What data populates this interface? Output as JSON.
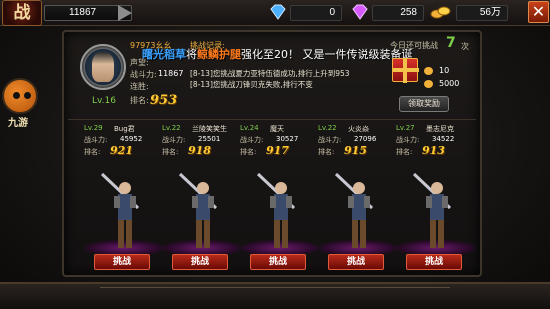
{
  "topbar": {
    "battle_icon_label": "战",
    "power_value": "11867",
    "diamond_blue": "0",
    "diamond_pink": "258",
    "gold": "56万",
    "close_label": "✕"
  },
  "sidebar": {
    "helper_label": "九游"
  },
  "player": {
    "name": "97973幺幺",
    "level": "Lv.16",
    "prestige_label": "声望:",
    "power_label": "战斗力:",
    "power_value": "11867",
    "streak_label": "连胜:",
    "rank_label": "排名:",
    "rank_value": "953"
  },
  "log": {
    "title": "挑战记录:",
    "marquee_name": "曙光稻草",
    "marquee_connector": "将",
    "marquee_item": "鲸鳞护腿",
    "marquee_tail": "强化至20！ 又是一件传说级装备诞",
    "lines": [
      "[8-13]您挑战夏力亚特伍德成功,排行上升到953",
      "[8-13]您挑战刀锋贝克失败,排行不变"
    ]
  },
  "today": {
    "label": "今日还可挑战",
    "count": "7",
    "unit": "次",
    "reward_a": "10",
    "reward_b": "5000",
    "claim_label": "领取奖励"
  },
  "opponents": [
    {
      "level": "Lv.29",
      "name": "Bug君",
      "power_label": "战斗力:",
      "power": "45952",
      "rank_label": "排名:",
      "rank": "921",
      "fight_label": "挑战"
    },
    {
      "level": "Lv.22",
      "name": "兰陵笑笑生",
      "power_label": "战斗力:",
      "power": "25501",
      "rank_label": "排名:",
      "rank": "918",
      "fight_label": "挑战"
    },
    {
      "level": "Lv.24",
      "name": "魔天",
      "power_label": "战斗力:",
      "power": "30527",
      "rank_label": "排名:",
      "rank": "917",
      "fight_label": "挑战"
    },
    {
      "level": "Lv.22",
      "name": "火炎焱",
      "power_label": "战斗力:",
      "power": "27096",
      "rank_label": "排名:",
      "rank": "915",
      "fight_label": "挑战"
    },
    {
      "level": "Lv.27",
      "name": "墨志尼克",
      "power_label": "战斗力:",
      "power": "34522",
      "rank_label": "排名:",
      "rank": "913",
      "fight_label": "挑战"
    }
  ],
  "colors": {
    "accent_gold": "#ffcc33",
    "level_green": "#7ed04a",
    "fight_red": "#b82a1a"
  }
}
